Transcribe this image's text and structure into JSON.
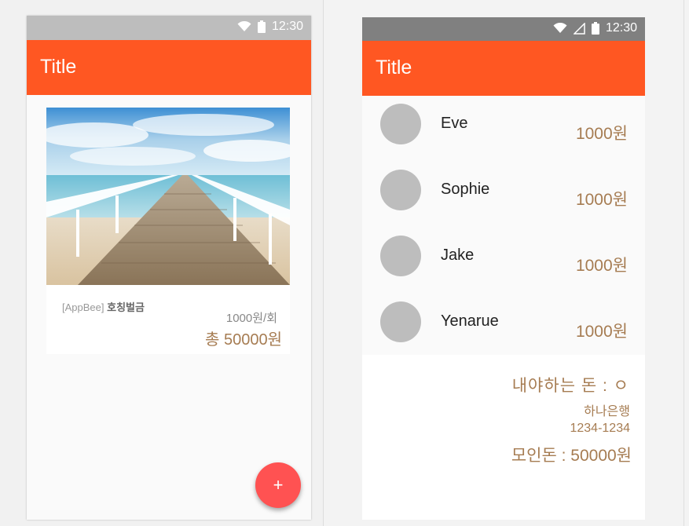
{
  "left_phone": {
    "status": {
      "time": "12:30",
      "icons": [
        "wifi-icon",
        "battery-icon"
      ]
    },
    "appbar": {
      "title": "Title"
    },
    "card": {
      "brand": "[AppBee]",
      "name": "호칭벌금",
      "unit_price": "1000원/회",
      "total": "총 50000원"
    },
    "fab": {
      "label": "+"
    }
  },
  "right_phone": {
    "status": {
      "time": "12:30",
      "icons": [
        "wifi-icon",
        "signal-icon",
        "battery-icon"
      ]
    },
    "appbar": {
      "title": "Title"
    },
    "members": [
      {
        "name": "Eve",
        "amount": "1000원"
      },
      {
        "name": "Sophie",
        "amount": "1000원"
      },
      {
        "name": "Jake",
        "amount": "1000원"
      },
      {
        "name": "Yenarue",
        "amount": "1000원"
      }
    ],
    "summary": {
      "owe": "내야하는 돈 : ㅇ",
      "bank_name": "하나은행",
      "account": "1234-1234",
      "collected": "모인돈 : 50000원"
    }
  },
  "colors": {
    "appbar": "#ff5722",
    "fab": "#ff5252",
    "amount_text": "#a67c52",
    "status_left": "#bdbdbd",
    "status_right": "#808080"
  }
}
